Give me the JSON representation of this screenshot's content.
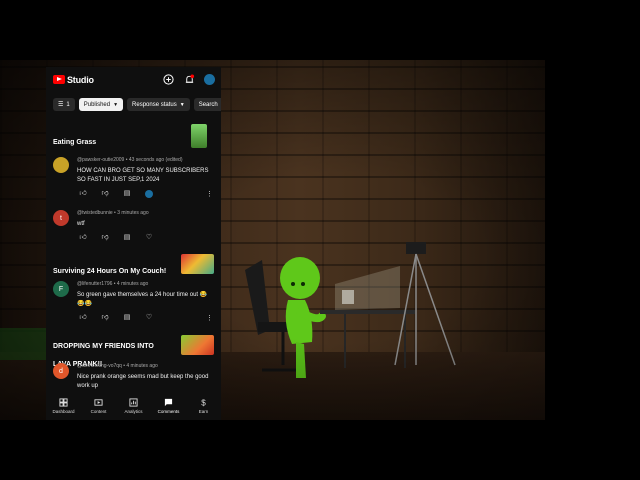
{
  "app": {
    "name": "Studio"
  },
  "filters": [
    {
      "label": "1",
      "icon": "filter-icon"
    },
    {
      "label": "Published"
    },
    {
      "label": "Response status"
    },
    {
      "label": "Search"
    }
  ],
  "videos": [
    {
      "title": "Eating Grass",
      "comments": [
        {
          "author": "@pawsker-outie2009",
          "time": "43 seconds ago (edited)",
          "text": "HOW CAN BRO GET SO MANY SUBSCRIBERS SO FAST IN JUST SEP,1 2024",
          "avatar_color": "#c9a227",
          "avatar_letter": ""
        }
      ]
    },
    {
      "comments": [
        {
          "author": "@twistedbunnie",
          "time": "3 minutes ago",
          "text": "wtf",
          "avatar_color": "#c0392b",
          "avatar_letter": "t"
        }
      ]
    },
    {
      "title": "Surviving 24 Hours On My Couch!",
      "comments": [
        {
          "author": "@lifenutter1796",
          "time": "4 minutes ago",
          "text": "So green gave themselves a 24 hour time out 😂😂😂",
          "avatar_color": "#1e6b4a",
          "avatar_letter": "F"
        }
      ]
    },
    {
      "title": "DROPPING MY FRIENDS INTO LAVA PRANK!!",
      "comments": [
        {
          "author": "@demonking-vo7qq",
          "time": "4 minutes ago",
          "text": "Nice prank orange seems mad but keep the good work up",
          "avatar_color": "#e0562a",
          "avatar_letter": "d"
        }
      ]
    }
  ],
  "bottom_nav": [
    {
      "label": "Dashboard",
      "icon": "dashboard-icon"
    },
    {
      "label": "Content",
      "icon": "content-icon"
    },
    {
      "label": "Analytics",
      "icon": "analytics-icon"
    },
    {
      "label": "Comments",
      "icon": "comments-icon",
      "active": true
    },
    {
      "label": "Earn",
      "icon": "earn-icon"
    }
  ],
  "colors": {
    "accent": "#ff0000",
    "bg": "#0f0f0f",
    "notif": "#ff0000"
  }
}
